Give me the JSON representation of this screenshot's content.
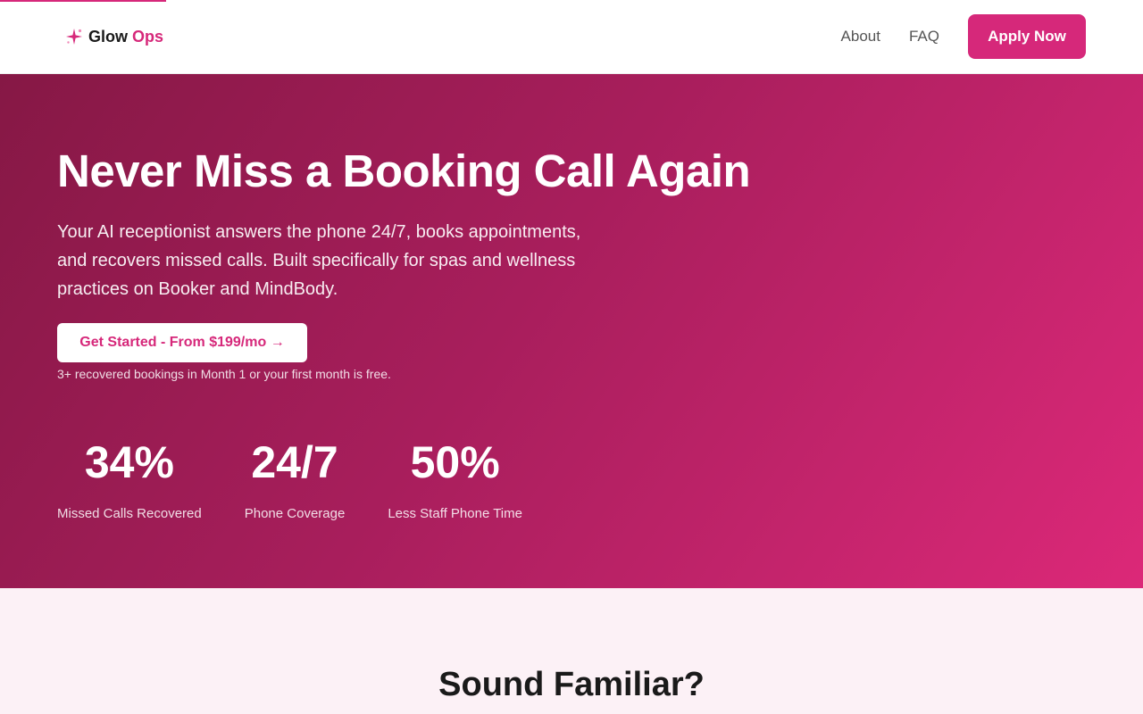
{
  "page_progress_percent": 14.5,
  "brand": {
    "name_part1": "Glow",
    "name_part2": "Ops",
    "icon": "sparkle-icon",
    "accent_color": "#d6287a"
  },
  "nav": {
    "about_label": "About",
    "faq_label": "FAQ",
    "apply_label": "Apply Now"
  },
  "hero": {
    "title": "Never Miss a Booking Call Again",
    "subtitle": "Your AI receptionist answers the phone 24/7, books appointments, and recovers missed calls. Built specifically for spas and wellness practices on Booker and MindBody.",
    "cta_label": "Get Started - From $199/mo →",
    "guarantee": "3+ recovered bookings in Month 1 or your first month is free.",
    "stats": [
      {
        "value": "34%",
        "label": "Missed Calls Recovered"
      },
      {
        "value": "24/7",
        "label": "Phone Coverage"
      },
      {
        "value": "50%",
        "label": "Less Staff Phone Time"
      }
    ]
  },
  "familiar": {
    "heading": "Sound Familiar?"
  }
}
